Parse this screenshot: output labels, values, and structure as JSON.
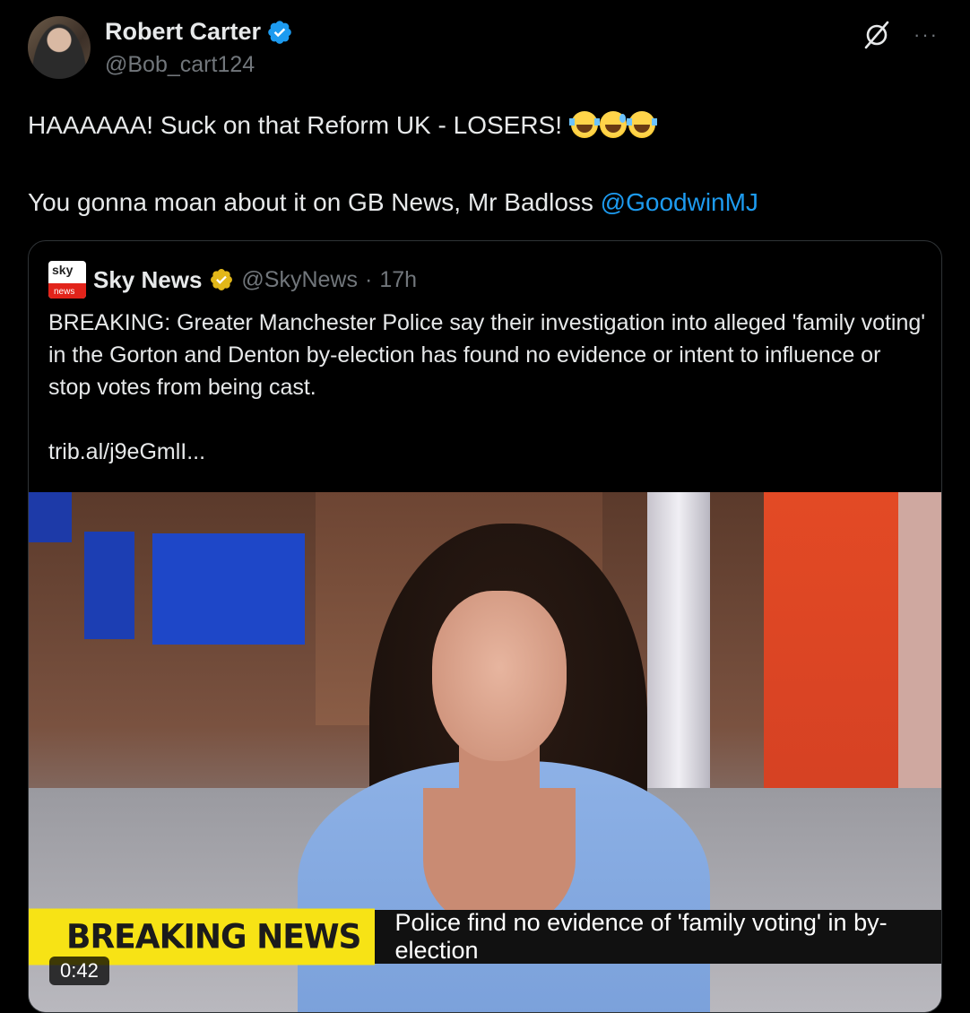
{
  "author": {
    "name": "Robert Carter",
    "handle": "@Bob_cart124",
    "verified": true
  },
  "post": {
    "line1": "HAAAAAA! Suck on that Reform UK - LOSERS!",
    "line2_text": "You gonna moan about it on GB News, Mr Badloss ",
    "mention": "@GoodwinMJ",
    "emojis": [
      "face-with-tears-of-joy",
      "grinning-face-with-sweat",
      "face-with-tears-of-joy"
    ]
  },
  "quote": {
    "name": "Sky News",
    "handle": "@SkyNews",
    "separator": "·",
    "time": "17h",
    "text": "BREAKING: Greater Manchester Police say their investigation into alleged 'family voting' in the Gorton and Denton by-election has found no evidence or intent to influence or stop votes from being cast.",
    "link": "trib.al/j9eGmlI...",
    "logo_top": "sky",
    "logo_bottom": "news"
  },
  "video": {
    "ticker_label": "BREAKING NEWS",
    "ticker_headline": "Police find no evidence of 'family voting' in by-election",
    "duration": "0:42"
  },
  "icons": {
    "grok": "grok-icon",
    "more": "more-icon"
  },
  "colors": {
    "background": "#000000",
    "link": "#1d9bf0",
    "ticker_yellow": "#f7e315",
    "verified_blue": "#1d9bf0",
    "gold_badge": "#e2b719"
  }
}
